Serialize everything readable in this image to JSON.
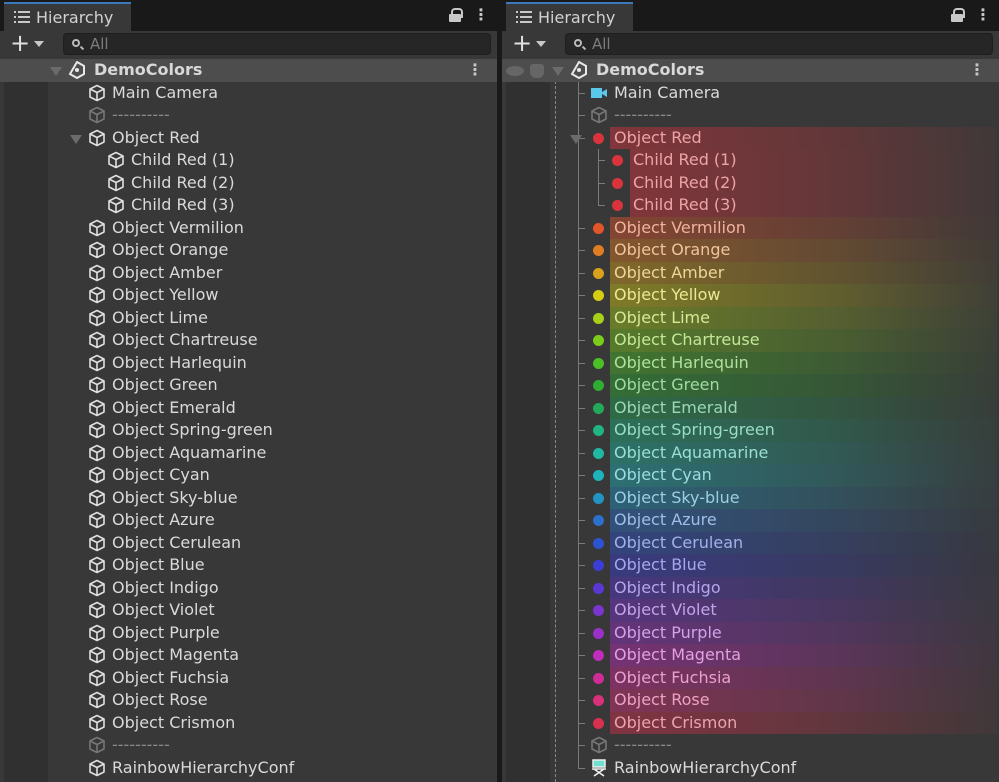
{
  "left": {
    "tab": "Hierarchy",
    "search_placeholder": "All"
  },
  "right": {
    "tab": "Hierarchy",
    "search_placeholder": "All"
  },
  "scene": "DemoColors",
  "items": [
    {
      "name": "Main Camera",
      "depth": 1,
      "icon": "camera-icon"
    },
    {
      "name": "----------",
      "depth": 1,
      "icon": "cube-icon",
      "dim": true
    },
    {
      "name": "Object Red",
      "depth": 1,
      "icon": "cube-icon",
      "color": "#d9343c",
      "foldable": true
    },
    {
      "name": "Child Red (1)",
      "depth": 2,
      "icon": "cube-icon",
      "color": "#d9343c"
    },
    {
      "name": "Child Red (2)",
      "depth": 2,
      "icon": "cube-icon",
      "color": "#d9343c"
    },
    {
      "name": "Child Red (3)",
      "depth": 2,
      "icon": "cube-icon",
      "color": "#d9343c"
    },
    {
      "name": "Object Vermilion",
      "depth": 1,
      "icon": "cube-icon",
      "color": "#e0562a"
    },
    {
      "name": "Object Orange",
      "depth": 1,
      "icon": "cube-icon",
      "color": "#e07d22"
    },
    {
      "name": "Object Amber",
      "depth": 1,
      "icon": "cube-icon",
      "color": "#d9a21a"
    },
    {
      "name": "Object Yellow",
      "depth": 1,
      "icon": "cube-icon",
      "color": "#d6cc14"
    },
    {
      "name": "Object Lime",
      "depth": 1,
      "icon": "cube-icon",
      "color": "#a8d018"
    },
    {
      "name": "Object Chartreuse",
      "depth": 1,
      "icon": "cube-icon",
      "color": "#7ccc1c"
    },
    {
      "name": "Object Harlequin",
      "depth": 1,
      "icon": "cube-icon",
      "color": "#4cbf26"
    },
    {
      "name": "Object Green",
      "depth": 1,
      "icon": "cube-icon",
      "color": "#2fae32"
    },
    {
      "name": "Object Emerald",
      "depth": 1,
      "icon": "cube-icon",
      "color": "#24a85a"
    },
    {
      "name": "Object Spring-green",
      "depth": 1,
      "icon": "cube-icon",
      "color": "#1fb482"
    },
    {
      "name": "Object Aquamarine",
      "depth": 1,
      "icon": "cube-icon",
      "color": "#1fb8a2"
    },
    {
      "name": "Object Cyan",
      "depth": 1,
      "icon": "cube-icon",
      "color": "#1fb4bc"
    },
    {
      "name": "Object Sky-blue",
      "depth": 1,
      "icon": "cube-icon",
      "color": "#2294c4"
    },
    {
      "name": "Object Azure",
      "depth": 1,
      "icon": "cube-icon",
      "color": "#2a70cc"
    },
    {
      "name": "Object Cerulean",
      "depth": 1,
      "icon": "cube-icon",
      "color": "#2d54d0"
    },
    {
      "name": "Object Blue",
      "depth": 1,
      "icon": "cube-icon",
      "color": "#3a3ed6"
    },
    {
      "name": "Object Indigo",
      "depth": 1,
      "icon": "cube-icon",
      "color": "#5a38d4"
    },
    {
      "name": "Object Violet",
      "depth": 1,
      "icon": "cube-icon",
      "color": "#7a34d0"
    },
    {
      "name": "Object Purple",
      "depth": 1,
      "icon": "cube-icon",
      "color": "#9a30c8"
    },
    {
      "name": "Object Magenta",
      "depth": 1,
      "icon": "cube-icon",
      "color": "#c02cbc"
    },
    {
      "name": "Object Fuchsia",
      "depth": 1,
      "icon": "cube-icon",
      "color": "#d02c96"
    },
    {
      "name": "Object Rose",
      "depth": 1,
      "icon": "cube-icon",
      "color": "#d8307a"
    },
    {
      "name": "Object Crismon",
      "depth": 1,
      "icon": "cube-icon",
      "color": "#d8304e"
    },
    {
      "name": "----------",
      "depth": 1,
      "icon": "cube-icon",
      "dim": true
    },
    {
      "name": "RainbowHierarchyConf",
      "depth": 1,
      "icon": "config-icon"
    }
  ]
}
